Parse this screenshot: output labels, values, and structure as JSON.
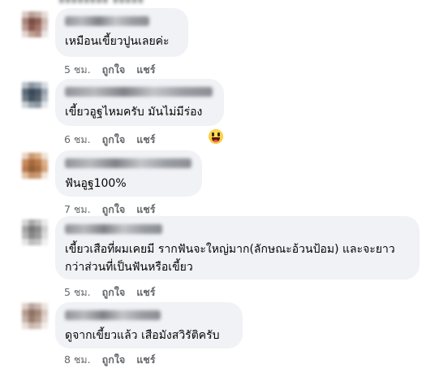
{
  "comments": [
    {
      "text": "เหมือนเขี้ยวปูนเลยค่ะ",
      "time": "5 ชม.",
      "like_label": "ถูกใจ",
      "share_label": "แชร์"
    },
    {
      "text": "เขี้ยวอูฐไหมครับ มันไม่มีร่อง",
      "time": "6 ชม.",
      "like_label": "ถูกใจ",
      "share_label": "แชร์",
      "reaction": "haha-icon"
    },
    {
      "text": "ฟันอูฐ100%",
      "time": "7 ชม.",
      "like_label": "ถูกใจ",
      "share_label": "แชร์"
    },
    {
      "text": "เขี้ยวเสือที่ผมเคยมี รากฟันจะใหญ่มาก(ลักษณะอ้วนป้อม) และจะยาวกว่าส่วนที่เป็นฟันหรือเขี้ยว",
      "time": "5 ชม.",
      "like_label": "ถูกใจ",
      "share_label": "แชร์"
    },
    {
      "text": "ดูจากเขี้ยวแล้ว เสือมังสวิรัติครับ",
      "time": "8 ชม.",
      "like_label": "ถูกใจ",
      "share_label": "แชร์"
    }
  ]
}
